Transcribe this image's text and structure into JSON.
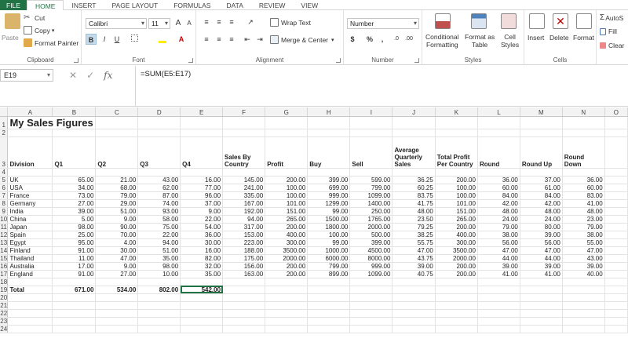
{
  "tabs": [
    "FILE",
    "HOME",
    "INSERT",
    "PAGE LAYOUT",
    "FORMULAS",
    "DATA",
    "REVIEW",
    "VIEW"
  ],
  "ribbon": {
    "clipboard": {
      "paste": "Paste",
      "cut": "Cut",
      "copy": "Copy",
      "format_painter": "Format Painter",
      "label": "Clipboard"
    },
    "font": {
      "name": "Calibri",
      "size": "11",
      "bold": "B",
      "italic": "I",
      "underline": "U",
      "grow": "A",
      "shrink": "A",
      "label": "Font"
    },
    "alignment": {
      "wrap": "Wrap Text",
      "merge": "Merge & Center",
      "label": "Alignment"
    },
    "number": {
      "format": "Number",
      "currency": "$",
      "percent": "%",
      "comma": ",",
      "label": "Number"
    },
    "styles": {
      "conditional_1": "Conditional",
      "conditional_2": "Formatting",
      "format_as_1": "Format as",
      "format_as_2": "Table",
      "cell_1": "Cell",
      "cell_2": "Styles",
      "label": "Styles"
    },
    "cells": {
      "insert": "Insert",
      "delete": "Delete",
      "format": "Format",
      "label": "Cells"
    },
    "editing": {
      "autosum": "AutoS",
      "fill": "Fill",
      "clear": "Clear"
    }
  },
  "formula_bar": {
    "name_box": "E19",
    "formula": "=SUM(E5:E17)",
    "fx": "fx",
    "cancel": "✕",
    "enter": "✓"
  },
  "sheet": {
    "columns": [
      "",
      "A",
      "B",
      "C",
      "D",
      "E",
      "F",
      "G",
      "H",
      "I",
      "J",
      "K",
      "L",
      "M",
      "N",
      "O"
    ],
    "title": "My Sales Figures",
    "headers": [
      "Division",
      "Q1",
      "Q2",
      "Q3",
      "Q4",
      "Sales By Country",
      "Profit",
      "Buy",
      "Sell",
      "Average Quarterly Sales",
      "Total Profit Per Country",
      "Round",
      "Round Up",
      "Round Down"
    ],
    "rows": [
      [
        "UK",
        "65.00",
        "21.00",
        "43.00",
        "16.00",
        "145.00",
        "200.00",
        "399.00",
        "599.00",
        "36.25",
        "200.00",
        "36.00",
        "37.00",
        "36.00"
      ],
      [
        "USA",
        "34.00",
        "68.00",
        "62.00",
        "77.00",
        "241.00",
        "100.00",
        "699.00",
        "799.00",
        "60.25",
        "100.00",
        "60.00",
        "61.00",
        "60.00"
      ],
      [
        "France",
        "73.00",
        "79.00",
        "87.00",
        "96.00",
        "335.00",
        "100.00",
        "999.00",
        "1099.00",
        "83.75",
        "100.00",
        "84.00",
        "84.00",
        "83.00"
      ],
      [
        "Germany",
        "27.00",
        "29.00",
        "74.00",
        "37.00",
        "167.00",
        "101.00",
        "1299.00",
        "1400.00",
        "41.75",
        "101.00",
        "42.00",
        "42.00",
        "41.00"
      ],
      [
        "India",
        "39.00",
        "51.00",
        "93.00",
        "9.00",
        "192.00",
        "151.00",
        "99.00",
        "250.00",
        "48.00",
        "151.00",
        "48.00",
        "48.00",
        "48.00"
      ],
      [
        "China",
        "5.00",
        "9.00",
        "58.00",
        "22.00",
        "94.00",
        "265.00",
        "1500.00",
        "1765.00",
        "23.50",
        "265.00",
        "24.00",
        "24.00",
        "23.00"
      ],
      [
        "Japan",
        "98.00",
        "90.00",
        "75.00",
        "54.00",
        "317.00",
        "200.00",
        "1800.00",
        "2000.00",
        "79.25",
        "200.00",
        "79.00",
        "80.00",
        "79.00"
      ],
      [
        "Spain",
        "25.00",
        "70.00",
        "22.00",
        "36.00",
        "153.00",
        "400.00",
        "100.00",
        "500.00",
        "38.25",
        "400.00",
        "38.00",
        "39.00",
        "38.00"
      ],
      [
        "Egypt",
        "95.00",
        "4.00",
        "94.00",
        "30.00",
        "223.00",
        "300.00",
        "99.00",
        "399.00",
        "55.75",
        "300.00",
        "56.00",
        "56.00",
        "55.00"
      ],
      [
        "Finland",
        "91.00",
        "30.00",
        "51.00",
        "16.00",
        "188.00",
        "3500.00",
        "1000.00",
        "4500.00",
        "47.00",
        "3500.00",
        "47.00",
        "47.00",
        "47.00"
      ],
      [
        "Thailand",
        "11.00",
        "47.00",
        "35.00",
        "82.00",
        "175.00",
        "2000.00",
        "6000.00",
        "8000.00",
        "43.75",
        "2000.00",
        "44.00",
        "44.00",
        "43.00"
      ],
      [
        "Australia",
        "17.00",
        "9.00",
        "98.00",
        "32.00",
        "156.00",
        "200.00",
        "799.00",
        "999.00",
        "39.00",
        "200.00",
        "39.00",
        "39.00",
        "39.00"
      ],
      [
        "England",
        "91.00",
        "27.00",
        "10.00",
        "35.00",
        "163.00",
        "200.00",
        "899.00",
        "1099.00",
        "40.75",
        "200.00",
        "41.00",
        "41.00",
        "40.00"
      ]
    ],
    "total": [
      "Total",
      "671.00",
      "534.00",
      "802.00",
      "542.00"
    ]
  }
}
